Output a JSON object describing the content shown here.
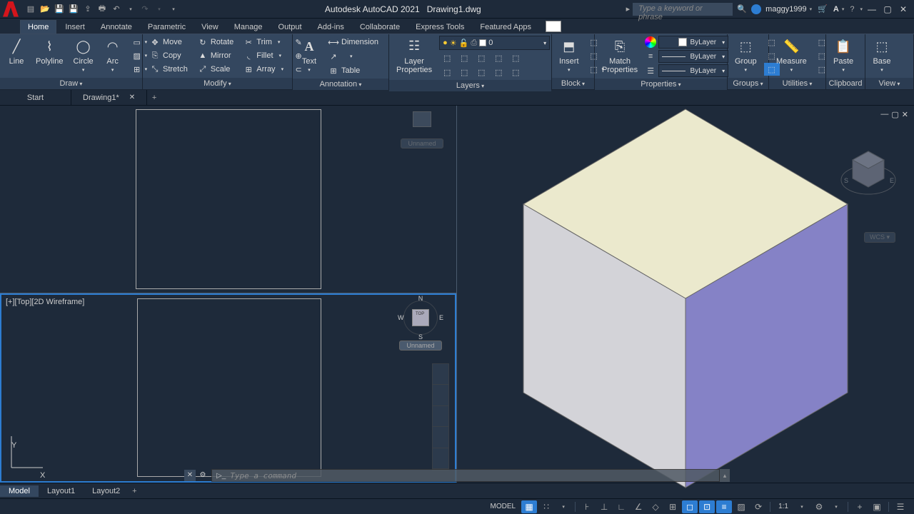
{
  "app": {
    "title": "Autodesk AutoCAD 2021",
    "file": "Drawing1.dwg"
  },
  "search": {
    "placeholder": "Type a keyword or phrase"
  },
  "user": {
    "name": "maggy1999"
  },
  "menu": {
    "tabs": [
      "Home",
      "Insert",
      "Annotate",
      "Parametric",
      "View",
      "Manage",
      "Output",
      "Add-ins",
      "Collaborate",
      "Express Tools",
      "Featured Apps"
    ],
    "active": 0
  },
  "ribbon": {
    "draw": {
      "title": "Draw",
      "line": "Line",
      "polyline": "Polyline",
      "circle": "Circle",
      "arc": "Arc"
    },
    "modify": {
      "title": "Modify",
      "move": "Move",
      "rotate": "Rotate",
      "trim": "Trim",
      "copy": "Copy",
      "mirror": "Mirror",
      "fillet": "Fillet",
      "stretch": "Stretch",
      "scale": "Scale",
      "array": "Array"
    },
    "annotation": {
      "title": "Annotation",
      "text": "Text",
      "dimension": "Dimension",
      "table": "Table"
    },
    "layers": {
      "title": "Layers",
      "props": "Layer\nProperties",
      "current": "0"
    },
    "block": {
      "title": "Block",
      "insert": "Insert"
    },
    "properties": {
      "title": "Properties",
      "match": "Match\nProperties",
      "bylayer": "ByLayer"
    },
    "groups": {
      "title": "Groups",
      "group": "Group"
    },
    "utilities": {
      "title": "Utilities",
      "measure": "Measure"
    },
    "clipboard": {
      "title": "Clipboard",
      "paste": "Paste"
    },
    "view": {
      "title": "View",
      "base": "Base"
    }
  },
  "doctabs": {
    "start": "Start",
    "drawing": "Drawing1*"
  },
  "viewport": {
    "label": "[+][Top][2D Wireframe]",
    "unnamed": "Unnamed",
    "top": "TOP"
  },
  "command": {
    "placeholder": "Type a command"
  },
  "bottomtabs": {
    "tabs": [
      "Model",
      "Layout1",
      "Layout2"
    ],
    "active": 0
  },
  "status": {
    "model": "MODEL",
    "scale": "1:1"
  }
}
